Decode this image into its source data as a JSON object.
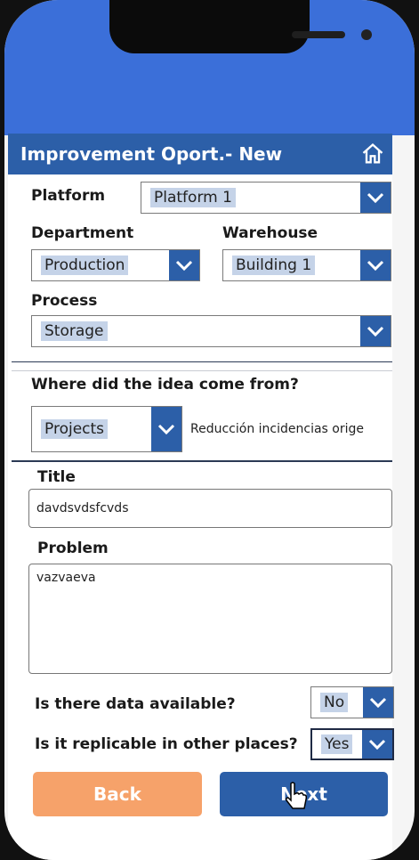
{
  "header": {
    "title": "Improvement Oport.- New"
  },
  "icons": {
    "home": "home-icon",
    "chevron": "chevron-down-icon"
  },
  "form": {
    "platform": {
      "label": "Platform",
      "value": "Platform 1"
    },
    "department": {
      "label": "Department",
      "value": "Production"
    },
    "warehouse": {
      "label": "Warehouse",
      "value": "Building 1"
    },
    "process": {
      "label": "Process",
      "value": "Storage"
    },
    "origin": {
      "label": "Where did the idea come from?",
      "value": "Projects",
      "note": "Reducción incidencias orige"
    },
    "title": {
      "label": "Title",
      "value": "davdsvdsfcvds"
    },
    "problem": {
      "label": "Problem",
      "value": "vazvaeva"
    },
    "data_available": {
      "label": "Is there data available?",
      "value": "No"
    },
    "replicable": {
      "label": "Is it replicable in other places?",
      "value": "Yes"
    }
  },
  "buttons": {
    "back": "Back",
    "next": "Next"
  },
  "colors": {
    "header_bg": "#2c5fa8",
    "status_bg": "#3b6fd9",
    "back_bg": "#f6a26a",
    "next_bg": "#2c5fa8"
  }
}
